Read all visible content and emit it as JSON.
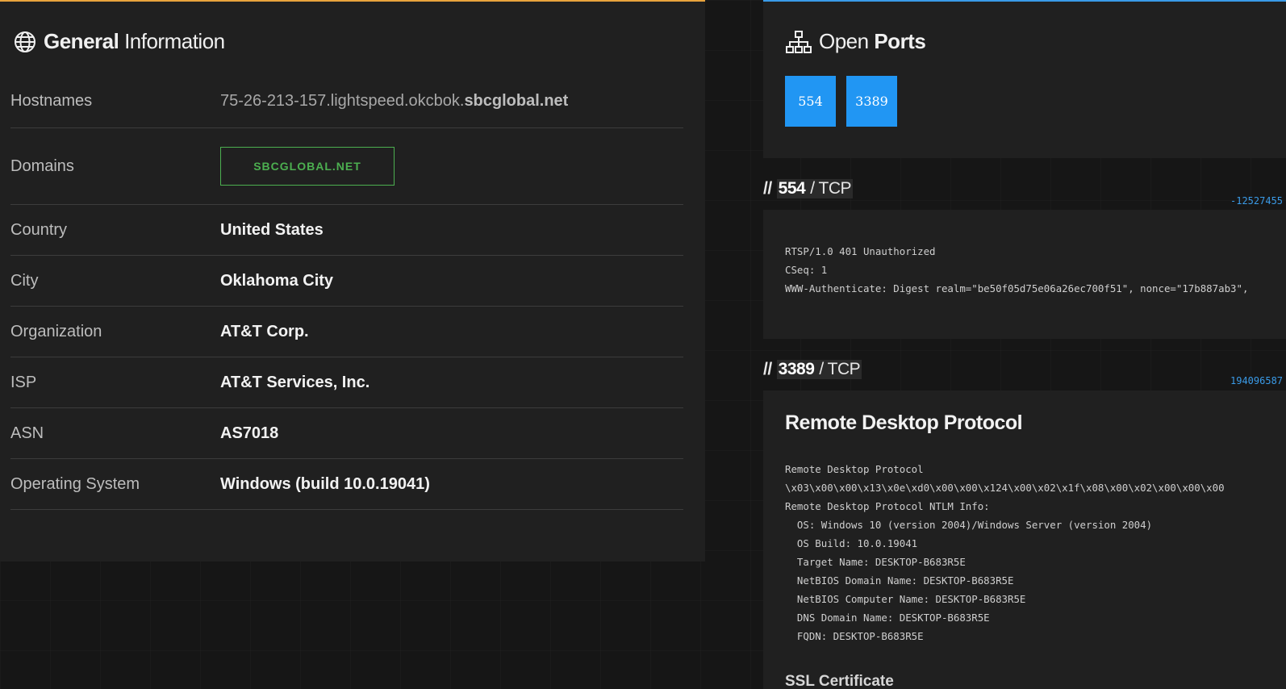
{
  "general": {
    "title_strong": "General",
    "title_light": "Information",
    "icon": "globe-icon",
    "accent": "#e8a33d",
    "rows": [
      {
        "label": "Hostnames",
        "value_prefix": "75-26-213-157.lightspeed.okcbok.",
        "value_suffix": "sbcglobal.net"
      },
      {
        "label": "Domains",
        "value": "SBCGLOBAL.NET"
      },
      {
        "label": "Country",
        "value": "United States"
      },
      {
        "label": "City",
        "value": "Oklahoma City"
      },
      {
        "label": "Organization",
        "value": "AT&T Corp."
      },
      {
        "label": "ISP",
        "value": "AT&T Services, Inc."
      },
      {
        "label": "ASN",
        "value": "AS7018"
      },
      {
        "label": "Operating System",
        "value": "Windows (build 10.0.19041)"
      }
    ]
  },
  "ports": {
    "title_light": "Open",
    "title_strong": "Ports",
    "icon": "sitemap-icon",
    "accent": "#3a9be8",
    "list": [
      "554",
      "3389"
    ]
  },
  "services": [
    {
      "slashes": "//",
      "port": "554",
      "proto": "/ TCP",
      "hash": "-12527455",
      "banner": "RTSP/1.0 401 Unauthorized\nCSeq: 1\nWWW-Authenticate: Digest realm=\"be50f05d75e06a26ec700f51\", nonce=\"17b887ab3\", "
    },
    {
      "slashes": "//",
      "port": "3389",
      "proto": "/ TCP",
      "hash": "194096587",
      "title": "Remote Desktop Protocol",
      "banner": "Remote Desktop Protocol\n\\x03\\x00\\x00\\x13\\x0e\\xd0\\x00\\x00\\x124\\x00\\x02\\x1f\\x08\\x00\\x02\\x00\\x00\\x00\nRemote Desktop Protocol NTLM Info:\n  OS: Windows 10 (version 2004)/Windows Server (version 2004)\n  OS Build: 10.0.19041\n  Target Name: DESKTOP-B683R5E\n  NetBIOS Domain Name: DESKTOP-B683R5E\n  NetBIOS Computer Name: DESKTOP-B683R5E\n  DNS Domain Name: DESKTOP-B683R5E\n  FQDN: DESKTOP-B683R5E",
      "ssl_title": "SSL Certificate"
    }
  ]
}
